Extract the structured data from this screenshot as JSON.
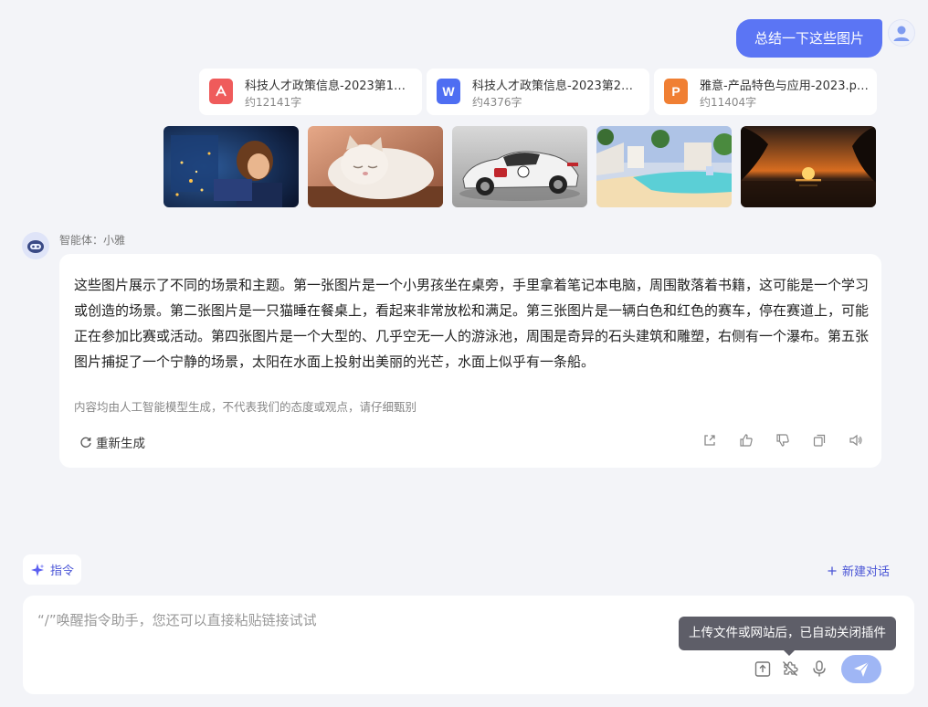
{
  "user": {
    "message": "总结一下这些图片"
  },
  "files": [
    {
      "name": "科技人才政策信息-2023第1期.pdf",
      "size": "约12141字",
      "type": "pdf",
      "icon": "pdf-icon",
      "color": "#ef5b5b",
      "glyph": "A"
    },
    {
      "name": "科技人才政策信息-2023第2期.docx",
      "size": "约4376字",
      "type": "word",
      "icon": "word-icon",
      "color": "#4e6ef2",
      "glyph": "W"
    },
    {
      "name": "雅意-产品特色与应用-2023.pptx",
      "size": "约11404字",
      "type": "ppt",
      "icon": "ppt-icon",
      "color": "#f07f33",
      "glyph": "P"
    }
  ],
  "images": [
    {
      "subject": "boy-with-laptop"
    },
    {
      "subject": "sleeping-cat"
    },
    {
      "subject": "race-car"
    },
    {
      "subject": "pool-with-statues"
    },
    {
      "subject": "sunset-over-water"
    }
  ],
  "agent": {
    "name": "智能体：小雅",
    "answer": "这些图片展示了不同的场景和主题。第一张图片是一个小男孩坐在桌旁，手里拿着笔记本电脑，周围散落着书籍，这可能是一个学习或创造的场景。第二张图片是一只猫睡在餐桌上，看起来非常放松和满足。第三张图片是一辆白色和红色的赛车，停在赛道上，可能正在参加比赛或活动。第四张图片是一个大型的、几乎空无一人的游泳池，周围是奇异的石头建筑和雕塑，右侧有一个瀑布。第五张图片捕捉了一个宁静的场景，太阳在水面上投射出美丽的光芒，水面上似乎有一条船。",
    "disclaimer": "内容均由人工智能模型生成，不代表我们的态度或观点，请仔细甄别",
    "regenerate_label": "重新生成"
  },
  "actions": [
    "share-icon",
    "thumbs-up-icon",
    "thumbs-down-icon",
    "copy-icon",
    "speaker-icon"
  ],
  "bottom": {
    "command_label": "指令",
    "new_chat_label": "新建对话"
  },
  "input": {
    "placeholder": "“/”唤醒指令助手，您还可以直接粘贴链接试试",
    "value": ""
  },
  "tooltip": {
    "text": "上传文件或网站后，已自动关闭插件"
  },
  "colors": {
    "accent": "#5b75f4",
    "link": "#4a55d6",
    "send_disabled": "#9fb6f5",
    "background": "#f3f4f8"
  }
}
